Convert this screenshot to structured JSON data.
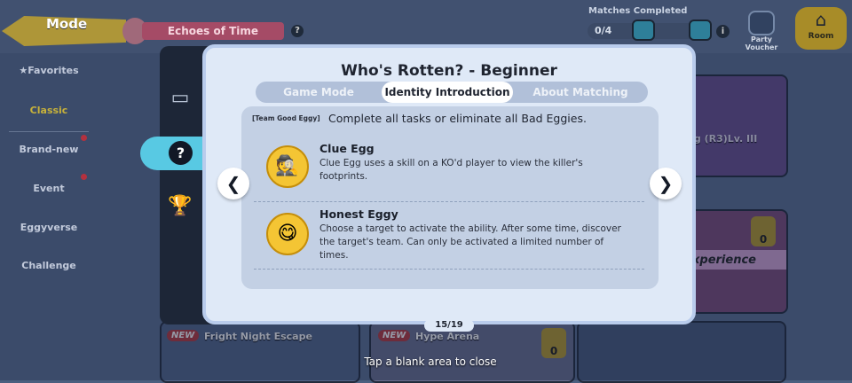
{
  "topbar": {
    "mode_label": "Mode",
    "event_title": "Echoes of Time",
    "help": "?",
    "matches_label": "Matches Completed",
    "matches_count": "0/4",
    "info": "i",
    "party_label_1": "Party",
    "party_label_2": "Voucher",
    "room_label": "Room"
  },
  "sidebar": {
    "items": [
      {
        "label": "Favorites"
      },
      {
        "label": "Classic"
      },
      {
        "label": "Brand-new"
      },
      {
        "label": "Event"
      },
      {
        "label": "Eggyverse"
      },
      {
        "label": "Challenge"
      }
    ]
  },
  "background": {
    "card_player": "gg (R3)Lv. III",
    "card_experience": "xperience",
    "card_experience_count": "0",
    "card1_badge": "NEW",
    "card1_title": "Fright Night Escape",
    "card2_badge": "NEW",
    "card2_title": "Hype Arena",
    "card2_count": "0"
  },
  "modal": {
    "title": "Who's Rotten? - Beginner",
    "tabs": [
      {
        "label": "Game Mode"
      },
      {
        "label": "Identity Introduction"
      },
      {
        "label": "About Matching"
      }
    ],
    "team_tag": "[Team Good Eggy]",
    "team_desc": "Complete all tasks or eliminate all Bad Eggies.",
    "roles": [
      {
        "name": "Clue Egg",
        "text": "Clue Egg uses a skill on a KO'd player to view the killer's footprints.",
        "icon": "detective-egg-icon"
      },
      {
        "name": "Honest Eggy",
        "text": "Choose a target to activate the ability. After some time, discover the target's team. Can only be activated a limited number of times.",
        "icon": "honest-egg-icon"
      }
    ],
    "page": "15/19",
    "prev": "❮",
    "next": "❯"
  },
  "footer": {
    "close_hint": "Tap a blank area to close"
  }
}
